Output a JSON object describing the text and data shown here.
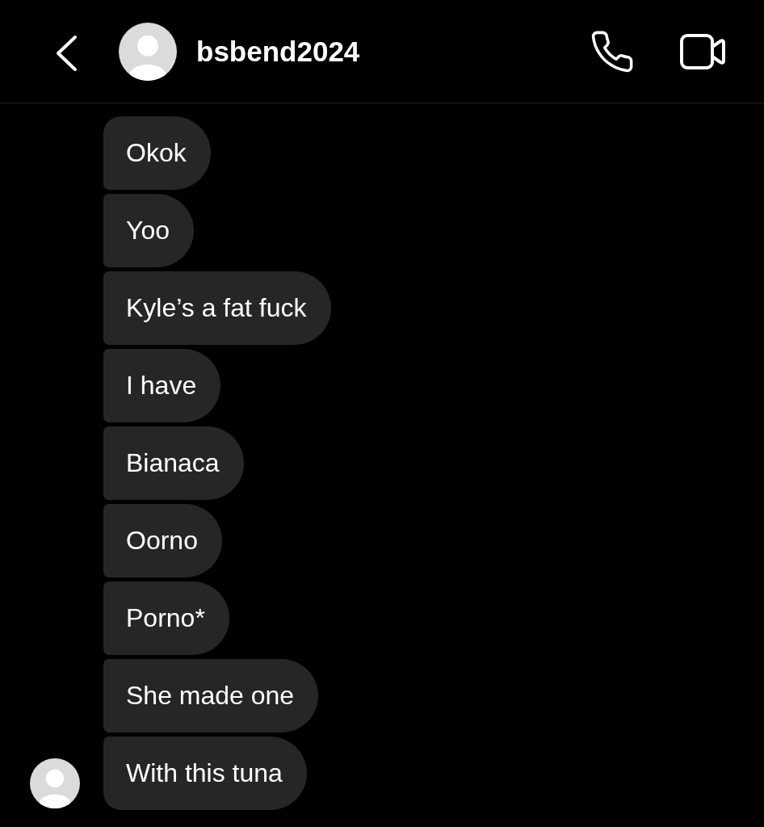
{
  "header": {
    "username": "bsbend2024"
  },
  "messages": [
    {
      "text": "Okok"
    },
    {
      "text": "Yoo"
    },
    {
      "text": "Kyle’s a fat fuck"
    },
    {
      "text": "I have"
    },
    {
      "text": "Bianaca"
    },
    {
      "text": "Oorno"
    },
    {
      "text": "Porno*"
    },
    {
      "text": "She made one"
    },
    {
      "text": "With this tuna"
    }
  ]
}
